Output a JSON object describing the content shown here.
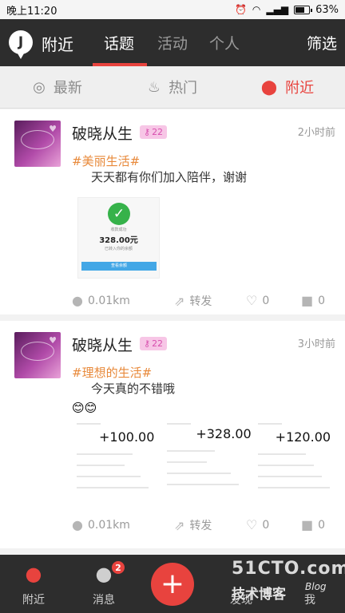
{
  "status_bar": {
    "time": "晚上11:20",
    "battery": "63%"
  },
  "header": {
    "title": "附近",
    "logo_letter": "J",
    "tabs": [
      {
        "label": "话题"
      },
      {
        "label": "活动"
      },
      {
        "label": "个人"
      }
    ],
    "active_tab": "话题",
    "filter_label": "筛选"
  },
  "sub_tabs": [
    {
      "label": "最新"
    },
    {
      "label": "热门"
    },
    {
      "label": "附近"
    }
  ],
  "active_sub_tab": "附近",
  "posts": [
    {
      "username": "破晓从生",
      "level": "22",
      "time": "2小时前",
      "tag": "#美丽生活#",
      "text": "天天都有你们加入陪伴，谢谢",
      "payment": {
        "title": "收款成功",
        "amount": "328.00元",
        "note": "已转入你的余额",
        "button": "查看余额"
      },
      "distance": "0.01km",
      "share_label": "转发",
      "likes": "0",
      "comments": "0"
    },
    {
      "username": "破晓从生",
      "level": "22",
      "time": "3小时前",
      "tag": "#理想的生活#",
      "text": "今天真的不错哦",
      "receipts": [
        {
          "amount": "+100.00"
        },
        {
          "amount": "+328.00"
        },
        {
          "amount": "+120.00"
        }
      ],
      "distance": "0.01km",
      "share_label": "转发",
      "likes": "0",
      "comments": "0"
    }
  ],
  "bottom_nav": {
    "nearby_label": "附近",
    "messages_label": "消息",
    "messages_badge": "2",
    "discover_label": "发现",
    "me_label": "我"
  },
  "watermark": {
    "line1": "51CTO.com",
    "line2": "技术博客",
    "line3": "Blog"
  }
}
